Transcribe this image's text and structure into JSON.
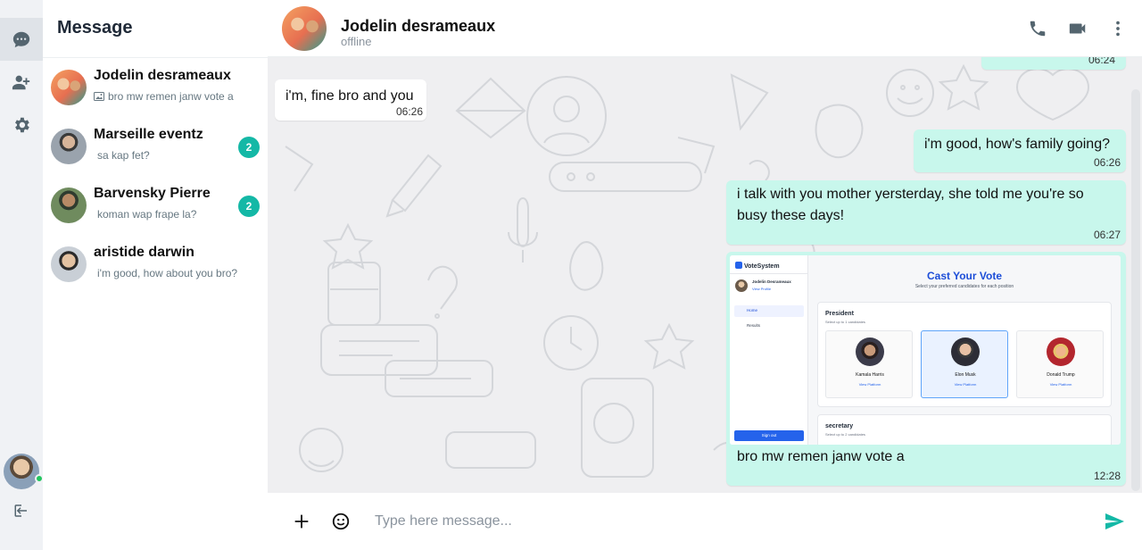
{
  "rail": {
    "items": [
      {
        "icon": "chat-icon",
        "active": true
      },
      {
        "icon": "add-contact-icon",
        "active": false
      },
      {
        "icon": "gear-icon",
        "active": false
      }
    ],
    "logout_icon": "logout-icon",
    "online_color": "#22c55e"
  },
  "sidebar": {
    "title": "Message",
    "contacts": [
      {
        "name": "Jodelin desrameaux",
        "preview": "bro mw remen janw vote a",
        "has_image": true,
        "unread": ""
      },
      {
        "name": "Marseille eventz",
        "preview": "sa kap fet?",
        "has_image": false,
        "unread": "2"
      },
      {
        "name": "Barvensky Pierre",
        "preview": "koman wap frape la?",
        "has_image": false,
        "unread": "2"
      },
      {
        "name": "aristide darwin",
        "preview": "i'm good, how about you bro?",
        "has_image": false,
        "unread": ""
      }
    ],
    "badge_color": "#14b8a6"
  },
  "chat_header": {
    "name": "Jodelin desrameaux",
    "status": "offline",
    "icons": [
      "phone-icon",
      "video-icon",
      "more-vert-icon"
    ]
  },
  "messages": [
    {
      "direction": "out",
      "text": "",
      "time": "06:24"
    },
    {
      "direction": "in",
      "text": "i'm, fine bro and you",
      "time": "06:26"
    },
    {
      "direction": "out",
      "text": "i'm good, how's family going?",
      "time": "06:26"
    },
    {
      "direction": "out",
      "text": "i talk with you mother yersterday, she told me you're so busy these days!",
      "time": "06:27"
    },
    {
      "direction": "out",
      "type": "image",
      "caption": "bro mw remen janw vote a",
      "time": "12:28",
      "image": {
        "app_name": "VoteSystem",
        "user_name": "Jodelin Desrameaux",
        "view_profile": "View Profile",
        "nav": [
          "Home",
          "Results"
        ],
        "sign_out": "Sign out",
        "title": "Cast Your Vote",
        "subtitle": "Select your preferred candidates for each position",
        "position1": "President",
        "position1_sub": "Select up to 1 candidates",
        "candidates": [
          {
            "name": "Kamala Harris",
            "platform": "View Platform",
            "selected": false
          },
          {
            "name": "Elon Musk",
            "platform": "View Platform",
            "selected": true
          },
          {
            "name": "Donald Trump",
            "platform": "View Platform",
            "selected": false
          }
        ],
        "position2": "secretary",
        "position2_sub": "Select up to 2 candidates"
      }
    }
  ],
  "bubble_colors": {
    "out": "#c8f7ec",
    "in": "#ffffff"
  },
  "composer": {
    "placeholder": "Type here message...",
    "icons": [
      "plus-icon",
      "emoji-icon",
      "send-icon"
    ],
    "send_color": "#14b8a6"
  }
}
